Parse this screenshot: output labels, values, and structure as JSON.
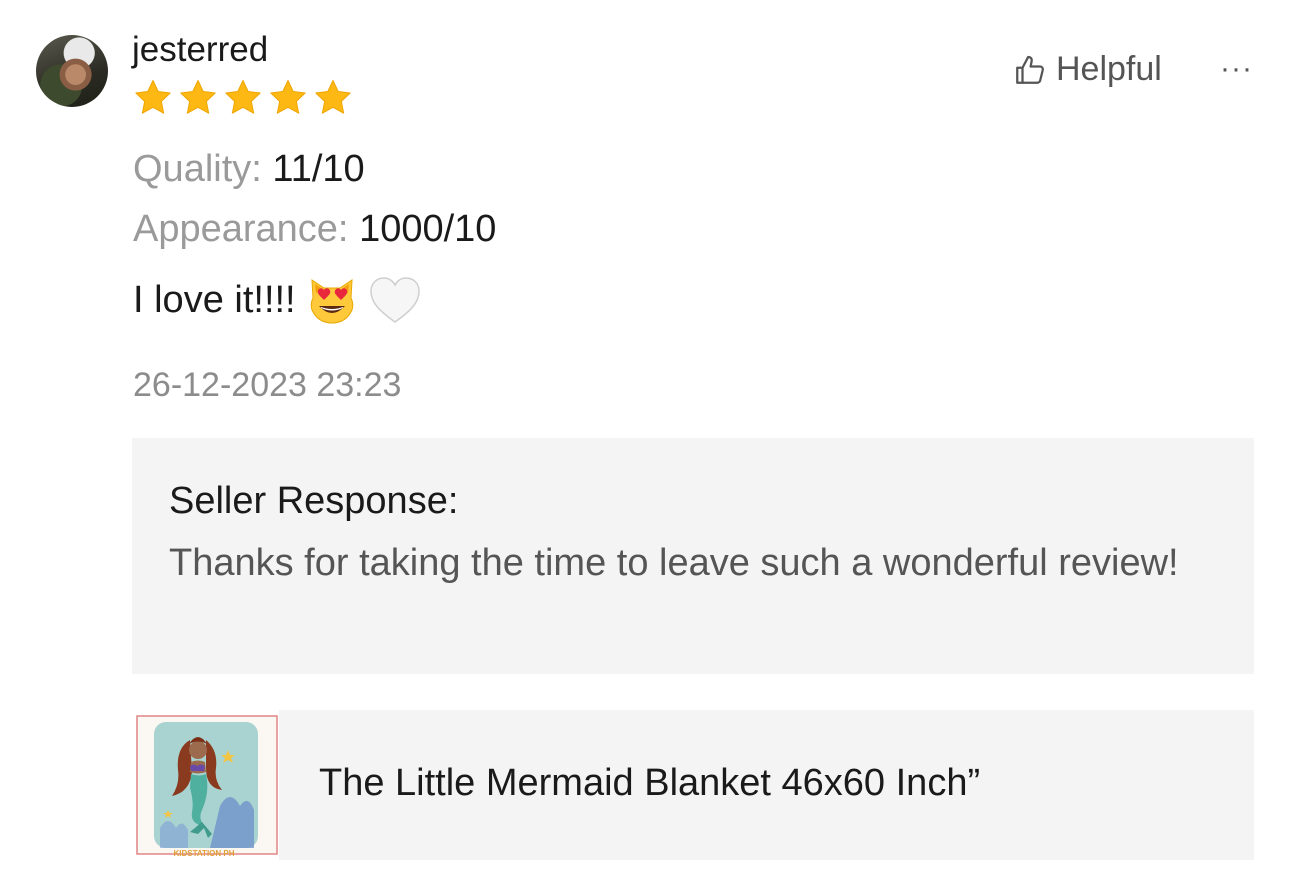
{
  "review": {
    "username": "jesterred",
    "star_count": 5,
    "star_color": "#FDB813",
    "helpful_label": "Helpful",
    "more_label": "···",
    "quality_label": "Quality:",
    "quality_value": "11/10",
    "appearance_label": "Appearance:",
    "appearance_value": "1000/10",
    "comment_text": "I love it!!!!",
    "comment_emojis": [
      "heart-eyes-cat-emoji",
      "white-heart-emoji"
    ],
    "timestamp": "26-12-2023 23:23"
  },
  "seller_response": {
    "title": "Seller Response:",
    "text": "Thanks for taking the time to leave such a wonderful review!"
  },
  "product": {
    "name": "The Little Mermaid Blanket 46x60 Inch”",
    "thumbnail_brand": "KIDSTATION PH"
  },
  "colors": {
    "label_gray": "#9a9a9a",
    "panel_bg": "#f4f4f4"
  }
}
